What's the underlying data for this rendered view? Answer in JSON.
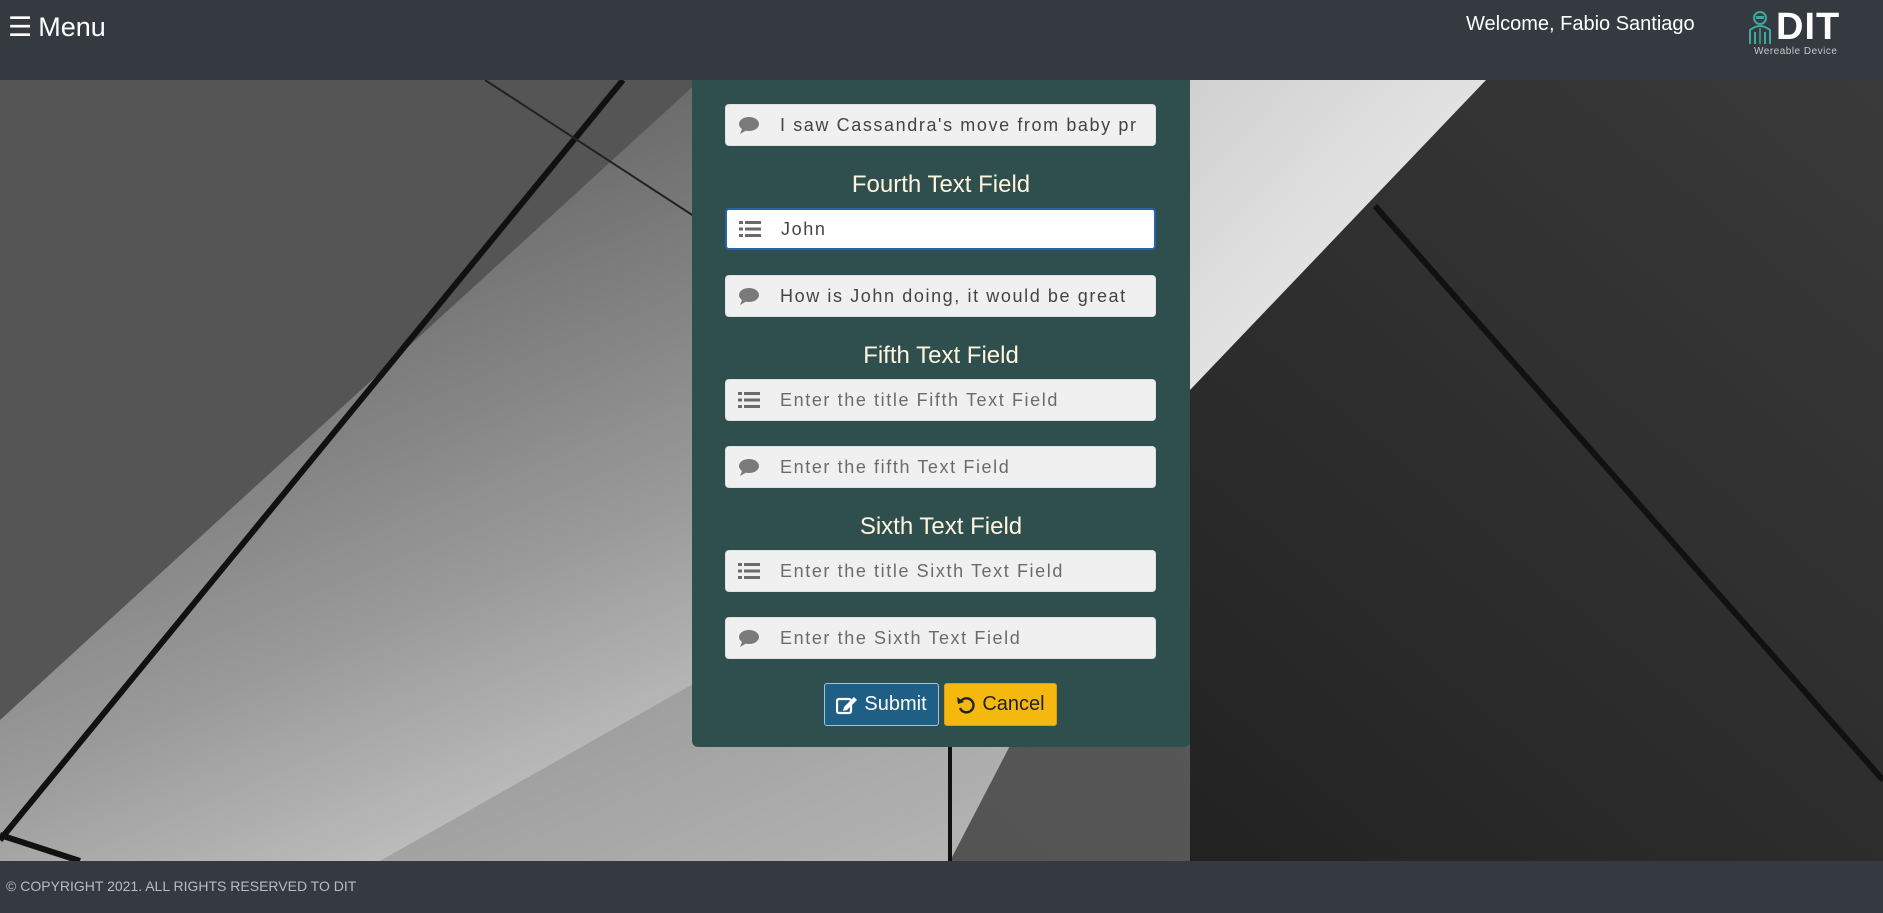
{
  "header": {
    "menu_icon": "hamburger-icon",
    "menu_label": "Menu",
    "welcome_text": "Welcome, Fabio Santiago",
    "logo_text": "DIT",
    "logo_subtitle": "Wereable Device"
  },
  "form": {
    "fields_top": {
      "message_value": "I saw Cassandra's move from baby pr"
    },
    "sections": [
      {
        "title": "Fourth Text Field",
        "title_value": "John",
        "title_placeholder": "",
        "message_value": "How is John doing, it would be great",
        "message_placeholder": ""
      },
      {
        "title": "Fifth Text Field",
        "title_value": "",
        "title_placeholder": "Enter the title Fifth Text Field",
        "message_value": "",
        "message_placeholder": "Enter the fifth Text Field"
      },
      {
        "title": "Sixth Text Field",
        "title_value": "",
        "title_placeholder": "Enter the title Sixth Text Field",
        "message_value": "",
        "message_placeholder": "Enter the Sixth Text Field"
      }
    ],
    "submit_label": "Submit",
    "cancel_label": "Cancel"
  },
  "footer": {
    "copyright": "© COPYRIGHT 2021. ALL RIGHTS RESERVED TO DIT"
  },
  "colors": {
    "header_bg": "#343a40",
    "card_bg": "#2f4f4f",
    "title_color": "#fff4dc",
    "submit_bg": "#1f5f86",
    "cancel_bg": "#f5b80e"
  }
}
